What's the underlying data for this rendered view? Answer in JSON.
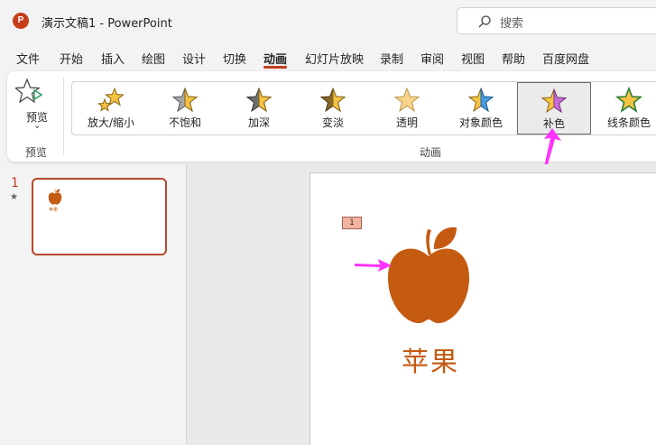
{
  "window": {
    "logo_letter": "P",
    "title": "演示文稿1  -  PowerPoint",
    "search_placeholder": "搜索"
  },
  "menu": {
    "items": [
      "文件",
      "开始",
      "插入",
      "绘图",
      "设计",
      "切换",
      "动画",
      "幻灯片放映",
      "录制",
      "审阅",
      "视图",
      "帮助",
      "百度网盘"
    ],
    "active": "动画"
  },
  "ribbon": {
    "preview_label": "预览",
    "preview_group": "预览",
    "animation_group": "动画",
    "effects": [
      {
        "label": "放大/缩小",
        "fill": "#f5c242"
      },
      {
        "label": "不饱和",
        "fill": "#a8a8a8"
      },
      {
        "label": "加深",
        "fill": "#6e6e6e"
      },
      {
        "label": "变淡",
        "fill": "#8a6a2a"
      },
      {
        "label": "透明",
        "fill": "#f8d38a"
      },
      {
        "label": "对象颜色",
        "fill": "#4a9be0"
      },
      {
        "label": "补色",
        "fill": "#c66fd6",
        "selected": true
      },
      {
        "label": "线条颜色",
        "fill": "#f5c242"
      }
    ]
  },
  "slides_pane": {
    "slide_number": "1",
    "transition_marker": "★",
    "thumb_caption": "苹果"
  },
  "slide": {
    "animation_tag": "1",
    "caption": "苹果",
    "apple_color": "#c55a11"
  },
  "colors": {
    "accent": "#c43e1c",
    "arrow": "#ff33ff"
  }
}
